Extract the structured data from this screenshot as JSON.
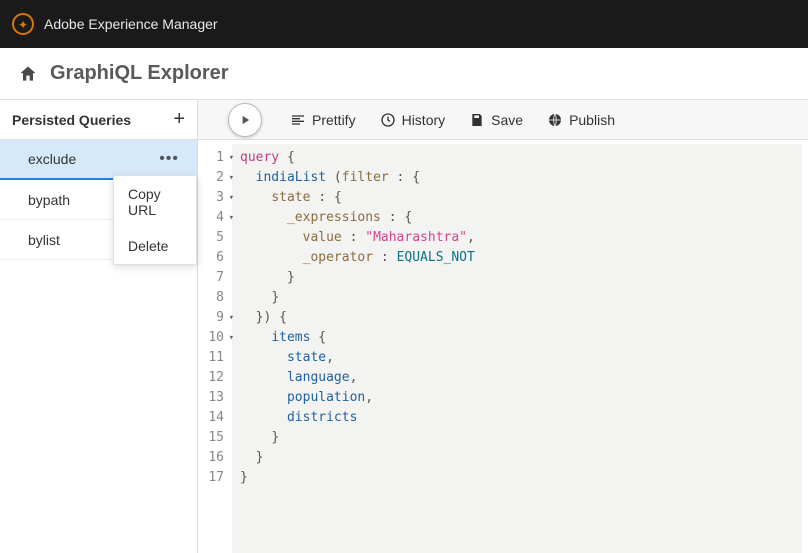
{
  "topbar": {
    "brand": "Adobe Experience Manager"
  },
  "titlebar": {
    "title": "GraphiQL Explorer"
  },
  "sidebar": {
    "header": "Persisted Queries",
    "items": [
      {
        "label": "exclude",
        "selected": true,
        "showMore": true
      },
      {
        "label": "bypath",
        "selected": false,
        "showMore": false
      },
      {
        "label": "bylist",
        "selected": false,
        "showMore": false
      }
    ]
  },
  "contextMenu": {
    "items": [
      {
        "label": "Copy URL"
      },
      {
        "label": "Delete"
      }
    ]
  },
  "toolbar": {
    "prettify": "Prettify",
    "history": "History",
    "save": "Save",
    "publish": "Publish"
  },
  "editor": {
    "lines": [
      {
        "n": 1,
        "fold": true,
        "tokens": [
          [
            "kw",
            "query"
          ],
          [
            "",
            ""
          ],
          [
            "brace",
            " {"
          ]
        ]
      },
      {
        "n": 2,
        "fold": true,
        "tokens": [
          [
            "",
            "  "
          ],
          [
            "field",
            "indiaList"
          ],
          [
            "",
            ""
          ],
          [
            "punct",
            " ("
          ],
          [
            "attr",
            "filter"
          ],
          [
            "punct",
            " : "
          ],
          [
            "brace",
            "{"
          ]
        ]
      },
      {
        "n": 3,
        "fold": true,
        "tokens": [
          [
            "",
            "    "
          ],
          [
            "attr",
            "state"
          ],
          [
            "punct",
            " : "
          ],
          [
            "brace",
            "{"
          ]
        ]
      },
      {
        "n": 4,
        "fold": true,
        "tokens": [
          [
            "",
            "      "
          ],
          [
            "attr",
            "_expressions"
          ],
          [
            "punct",
            " : "
          ],
          [
            "brace",
            "{"
          ]
        ]
      },
      {
        "n": 5,
        "fold": false,
        "tokens": [
          [
            "",
            "        "
          ],
          [
            "attr",
            "value"
          ],
          [
            "punct",
            " : "
          ],
          [
            "str",
            "\"Maharashtra\""
          ],
          [
            "punct",
            ","
          ]
        ]
      },
      {
        "n": 6,
        "fold": false,
        "tokens": [
          [
            "",
            "        "
          ],
          [
            "attr",
            "_operator"
          ],
          [
            "punct",
            " : "
          ],
          [
            "enum",
            "EQUALS_NOT"
          ]
        ]
      },
      {
        "n": 7,
        "fold": false,
        "tokens": [
          [
            "",
            "      "
          ],
          [
            "brace",
            "}"
          ]
        ]
      },
      {
        "n": 8,
        "fold": false,
        "tokens": [
          [
            "",
            "    "
          ],
          [
            "brace",
            "}"
          ]
        ]
      },
      {
        "n": 9,
        "fold": true,
        "tokens": [
          [
            "",
            "  "
          ],
          [
            "brace",
            "}"
          ],
          [
            "punct",
            ")"
          ],
          [
            "brace",
            " {"
          ]
        ]
      },
      {
        "n": 10,
        "fold": true,
        "tokens": [
          [
            "",
            "    "
          ],
          [
            "field",
            "items"
          ],
          [
            "brace",
            " {"
          ]
        ]
      },
      {
        "n": 11,
        "fold": false,
        "tokens": [
          [
            "",
            "      "
          ],
          [
            "field",
            "state"
          ],
          [
            "punct",
            ","
          ]
        ]
      },
      {
        "n": 12,
        "fold": false,
        "tokens": [
          [
            "",
            "      "
          ],
          [
            "field",
            "language"
          ],
          [
            "punct",
            ","
          ]
        ]
      },
      {
        "n": 13,
        "fold": false,
        "tokens": [
          [
            "",
            "      "
          ],
          [
            "field",
            "population"
          ],
          [
            "punct",
            ","
          ]
        ]
      },
      {
        "n": 14,
        "fold": false,
        "tokens": [
          [
            "",
            "      "
          ],
          [
            "field",
            "districts"
          ]
        ]
      },
      {
        "n": 15,
        "fold": false,
        "tokens": [
          [
            "",
            "    "
          ],
          [
            "brace",
            "}"
          ]
        ]
      },
      {
        "n": 16,
        "fold": false,
        "tokens": [
          [
            "",
            "  "
          ],
          [
            "brace",
            "}"
          ]
        ]
      },
      {
        "n": 17,
        "fold": false,
        "tokens": [
          [
            "brace",
            "}"
          ]
        ]
      }
    ]
  }
}
